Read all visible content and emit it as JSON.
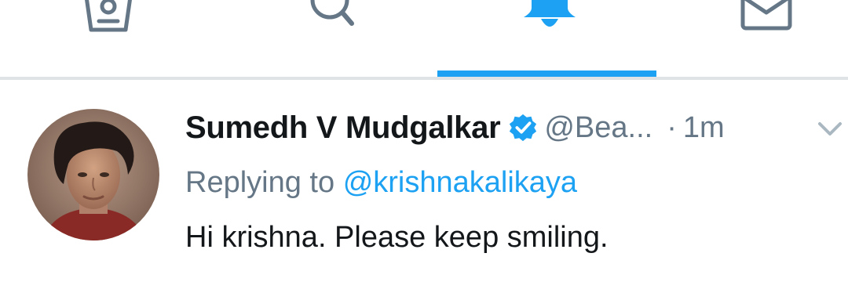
{
  "tabs": [
    {
      "name": "home",
      "icon": "home-icon",
      "active": false
    },
    {
      "name": "search",
      "icon": "search-icon",
      "active": false
    },
    {
      "name": "notifications",
      "icon": "bell-icon",
      "active": true
    },
    {
      "name": "messages",
      "icon": "envelope-icon",
      "active": false
    }
  ],
  "colors": {
    "accent": "#1da1f2",
    "icon_inactive": "#657786",
    "text_primary": "#14171a",
    "text_secondary": "#657786"
  },
  "tweet": {
    "display_name": "Sumedh V Mudgalkar",
    "verified": true,
    "handle": "@Bea...",
    "separator": "·",
    "time": "1m",
    "reply_label": "Replying to",
    "reply_to": "@krishnakalikaya",
    "text": "Hi krishna. Please keep smiling."
  }
}
